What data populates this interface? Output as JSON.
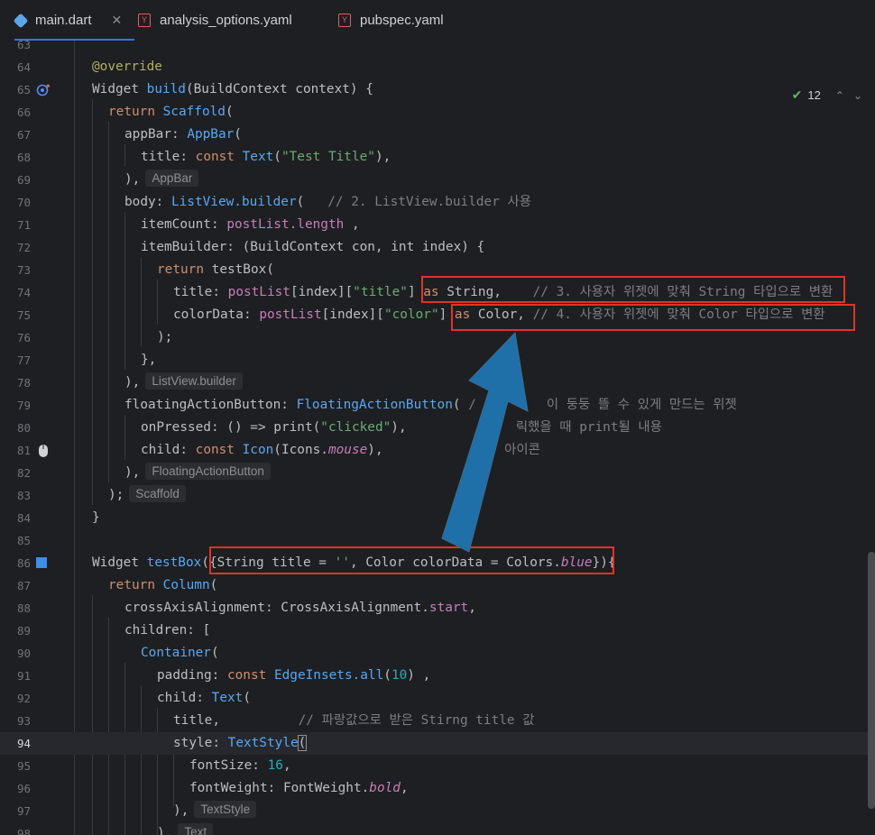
{
  "tabs": [
    {
      "label": "main.dart",
      "close": "✕",
      "icon": "dart-file-icon"
    },
    {
      "label": "analysis_options.yaml",
      "icon": "yaml-file-icon"
    },
    {
      "label": "pubspec.yaml",
      "icon": "yaml-file-icon"
    }
  ],
  "inspection": {
    "count": "12",
    "up": "⌃",
    "down": "⌄"
  },
  "lines": [
    {
      "n": "63"
    },
    {
      "n": "64"
    },
    {
      "n": "65"
    },
    {
      "n": "66"
    },
    {
      "n": "67"
    },
    {
      "n": "68"
    },
    {
      "n": "69"
    },
    {
      "n": "70"
    },
    {
      "n": "71"
    },
    {
      "n": "72"
    },
    {
      "n": "73"
    },
    {
      "n": "74"
    },
    {
      "n": "75"
    },
    {
      "n": "76"
    },
    {
      "n": "77"
    },
    {
      "n": "78"
    },
    {
      "n": "79"
    },
    {
      "n": "80"
    },
    {
      "n": "81"
    },
    {
      "n": "82"
    },
    {
      "n": "83"
    },
    {
      "n": "84"
    },
    {
      "n": "85"
    },
    {
      "n": "86"
    },
    {
      "n": "87"
    },
    {
      "n": "88"
    },
    {
      "n": "89"
    },
    {
      "n": "90"
    },
    {
      "n": "91"
    },
    {
      "n": "92"
    },
    {
      "n": "93"
    },
    {
      "n": "94"
    },
    {
      "n": "95"
    },
    {
      "n": "96"
    },
    {
      "n": "97"
    },
    {
      "n": "98"
    }
  ],
  "code": {
    "l64": "@override",
    "l65a": "Widget ",
    "l65b": "build",
    "l65c": "(BuildContext context) {",
    "l66a": "return ",
    "l66b": "Scaffold",
    "l66c": "(",
    "l67a": "appBar: ",
    "l67b": "AppBar",
    "l67c": "(",
    "l68a": "title: ",
    "l68b": "const ",
    "l68c": "Text",
    "l68d": "(",
    "l68e": "\"Test Title\"",
    "l68f": "),",
    "l69a": "),",
    "l69hint": "AppBar",
    "l70a": "body: ",
    "l70b": "ListView.builder",
    "l70c": "(   ",
    "l70d": "// 2. ListView.builder 사용",
    "l71a": "itemCount: ",
    "l71b": "postList",
    "l71c": ".",
    "l71d": "length",
    "l71e": " ,",
    "l72a": "itemBuilder: (BuildContext con, ",
    "l72b": "int",
    "l72c": " index) {",
    "l73a": "return ",
    "l73b": "testBox(",
    "l74a": "title: ",
    "l74b": "postList",
    "l74c": "[index][",
    "l74d": "\"title\"",
    "l74e": "] ",
    "l74f": "as ",
    "l74g": "String,    ",
    "l74h": "// 3. 사용자 위젯에 맞춰 String 타입으로 변환",
    "l75a": "colorData: ",
    "l75b": "postList",
    "l75c": "[index][",
    "l75d": "\"color\"",
    "l75e": "] ",
    "l75f": "as ",
    "l75g": "Color, ",
    "l75h": "// 4. 사용자 위젯에 맞춰 Color 타입으로 변환",
    "l76": ");",
    "l77": "},",
    "l78a": "),",
    "l78hint": "ListView.builder",
    "l79a": "floatingActionButton: ",
    "l79b": "FloatingActionButton",
    "l79c": "( ",
    "l79d": "/         이 둥둥 뜰 수 있게 만드는 위젯",
    "l80a": "onPressed: () => ",
    "l80b": "print",
    "l80c": "(",
    "l80d": "\"clicked\"",
    "l80e": "),",
    "l80f": "              릭했을 때 print될 내용",
    "l81a": "child: ",
    "l81b": "const ",
    "l81c": "Icon",
    "l81d": "(Icons.",
    "l81e": "mouse",
    "l81f": "),",
    "l81g": "             튼 아이콘",
    "l82a": "),",
    "l82hint": "FloatingActionButton",
    "l83a": ");",
    "l83hint": "Scaffold",
    "l84": "}",
    "l86a": "Widget ",
    "l86b": "testBox",
    "l86c": "({String title = ",
    "l86d": "''",
    "l86e": ", Color colorData = Colors.",
    "l86f": "blue",
    "l86g": "}){",
    "l87a": "return ",
    "l87b": "Column",
    "l87c": "(",
    "l88a": "crossAxisAlignment: CrossAxisAlignment.",
    "l88b": "start",
    "l88c": ",",
    "l89": "children: [",
    "l90a": "Container",
    "l90b": "(",
    "l91a": "padding: ",
    "l91b": "const ",
    "l91c": "EdgeInsets.all",
    "l91d": "(",
    "l91e": "10",
    "l91f": ") ,",
    "l92a": "child: ",
    "l92b": "Text",
    "l92c": "(",
    "l93a": "title,          ",
    "l93b": "// 파랑값으로 받은 Stirng title 값",
    "l94a": "style: ",
    "l94b": "TextStyle",
    "l94c": "(",
    "l95a": "fontSize: ",
    "l95b": "16",
    "l95c": ",",
    "l96a": "fontWeight: FontWeight.",
    "l96b": "bold",
    "l96c": ",",
    "l97a": "),",
    "l97hint": "TextStyle",
    "l98a": "),",
    "l98hint": "Text"
  },
  "colors": {
    "background": "#1e1f22",
    "annotation_box": "#e2322a",
    "arrow": "#1f6fa8",
    "tab_accent": "#3574f0"
  }
}
